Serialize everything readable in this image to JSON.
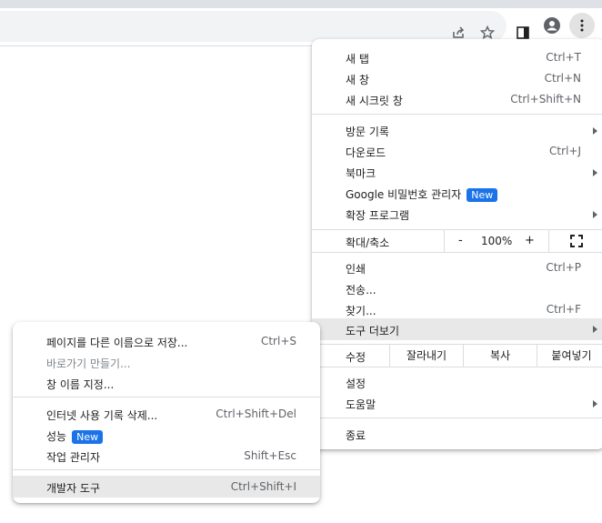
{
  "main_menu": {
    "new_tab": {
      "label": "새 탭",
      "shortcut": "Ctrl+T"
    },
    "new_window": {
      "label": "새 창",
      "shortcut": "Ctrl+N"
    },
    "new_incognito": {
      "label": "새 시크릿 창",
      "shortcut": "Ctrl+Shift+N"
    },
    "history": {
      "label": "방문 기록"
    },
    "downloads": {
      "label": "다운로드",
      "shortcut": "Ctrl+J"
    },
    "bookmarks": {
      "label": "북마크"
    },
    "passwords": {
      "label": "Google 비밀번호 관리자",
      "badge": "New"
    },
    "extensions": {
      "label": "확장 프로그램"
    },
    "zoom": {
      "label": "확대/축소",
      "minus": "-",
      "value": "100%",
      "plus": "+"
    },
    "print": {
      "label": "인쇄",
      "shortcut": "Ctrl+P"
    },
    "cast": {
      "label": "전송..."
    },
    "find": {
      "label": "찾기...",
      "shortcut": "Ctrl+F"
    },
    "more_tools": {
      "label": "도구 더보기"
    },
    "edit": {
      "label": "수정",
      "cut": "잘라내기",
      "copy": "복사",
      "paste": "붙여넣기"
    },
    "settings": {
      "label": "설정"
    },
    "help": {
      "label": "도움말"
    },
    "exit": {
      "label": "종료"
    }
  },
  "sub_menu": {
    "save_page": {
      "label": "페이지를 다른 이름으로 저장...",
      "shortcut": "Ctrl+S"
    },
    "create_shortcut": {
      "label": "바로가기 만들기..."
    },
    "name_window": {
      "label": "창 이름 지정..."
    },
    "clear_data": {
      "label": "인터넷 사용 기록 삭제...",
      "shortcut": "Ctrl+Shift+Del"
    },
    "performance": {
      "label": "성능",
      "badge": "New"
    },
    "task_manager": {
      "label": "작업 관리자",
      "shortcut": "Shift+Esc"
    },
    "dev_tools": {
      "label": "개발자 도구",
      "shortcut": "Ctrl+Shift+I"
    }
  },
  "colors": {
    "accent": "#1a73e8",
    "highlight": "#e8e8e8",
    "disabled": "#80868b"
  }
}
